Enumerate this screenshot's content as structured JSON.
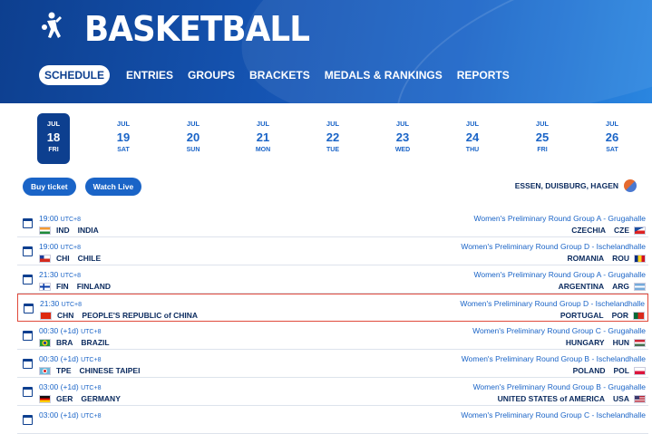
{
  "header": {
    "title": "BASKETBALL",
    "nav": [
      "SCHEDULE",
      "ENTRIES",
      "GROUPS",
      "BRACKETS",
      "MEDALS & RANKINGS",
      "REPORTS"
    ]
  },
  "dates": [
    {
      "month": "JUL",
      "day": "18",
      "weekday": "FRI",
      "active": true
    },
    {
      "month": "JUL",
      "day": "19",
      "weekday": "SAT"
    },
    {
      "month": "JUL",
      "day": "20",
      "weekday": "SUN"
    },
    {
      "month": "JUL",
      "day": "21",
      "weekday": "MON"
    },
    {
      "month": "JUL",
      "day": "22",
      "weekday": "TUE"
    },
    {
      "month": "JUL",
      "day": "23",
      "weekday": "WED"
    },
    {
      "month": "JUL",
      "day": "24",
      "weekday": "THU"
    },
    {
      "month": "JUL",
      "day": "25",
      "weekday": "FRI"
    },
    {
      "month": "JUL",
      "day": "26",
      "weekday": "SAT"
    }
  ],
  "actions": {
    "buy_ticket": "Buy ticket",
    "watch_live": "Watch Live"
  },
  "venue": "ESSEN, DUISBURG, HAGEN",
  "matches": [
    {
      "time": "19:00",
      "utc": "UTC+8",
      "team1_code": "IND",
      "team1_name": "INDIA",
      "team1_flag": "india",
      "event": "Women's Preliminary Round Group A - Grugahalle",
      "team2_name": "CZECHIA",
      "team2_code": "CZE",
      "team2_flag": "czechia"
    },
    {
      "time": "19:00",
      "utc": "UTC+8",
      "team1_code": "CHI",
      "team1_name": "CHILE",
      "team1_flag": "chile",
      "event": "Women's Preliminary Round Group D - Ischelandhalle",
      "team2_name": "ROMANIA",
      "team2_code": "ROU",
      "team2_flag": "romania"
    },
    {
      "time": "21:30",
      "utc": "UTC+8",
      "team1_code": "FIN",
      "team1_name": "FINLAND",
      "team1_flag": "finland",
      "event": "Women's Preliminary Round Group A - Grugahalle",
      "team2_name": "ARGENTINA",
      "team2_code": "ARG",
      "team2_flag": "argentina"
    },
    {
      "time": "21:30",
      "utc": "UTC+8",
      "team1_code": "CHN",
      "team1_name": "PEOPLE'S REPUBLIC of CHINA",
      "team1_flag": "china",
      "event": "Women's Preliminary Round Group D - Ischelandhalle",
      "team2_name": "PORTUGAL",
      "team2_code": "POR",
      "team2_flag": "portugal",
      "highlight": true
    },
    {
      "time": "00:30 (+1d)",
      "utc": "UTC+8",
      "team1_code": "BRA",
      "team1_name": "BRAZIL",
      "team1_flag": "brazil",
      "event": "Women's Preliminary Round Group C - Grugahalle",
      "team2_name": "HUNGARY",
      "team2_code": "HUN",
      "team2_flag": "hungary"
    },
    {
      "time": "00:30 (+1d)",
      "utc": "UTC+8",
      "team1_code": "TPE",
      "team1_name": "CHINESE TAIPEI",
      "team1_flag": "chinese-taipei",
      "event": "Women's Preliminary Round Group B - Ischelandhalle",
      "team2_name": "POLAND",
      "team2_code": "POL",
      "team2_flag": "poland"
    },
    {
      "time": "03:00 (+1d)",
      "utc": "UTC+8",
      "team1_code": "GER",
      "team1_name": "GERMANY",
      "team1_flag": "germany",
      "event": "Women's Preliminary Round Group B - Grugahalle",
      "team2_name": "UNITED STATES of AMERICA",
      "team2_code": "USA",
      "team2_flag": "usa"
    },
    {
      "time": "03:00 (+1d)",
      "utc": "UTC+8",
      "team1_code": "",
      "team1_name": "",
      "team1_flag": "",
      "event": "Women's Preliminary Round Group C - Ischelandhalle",
      "team2_name": "",
      "team2_code": "",
      "team2_flag": ""
    }
  ]
}
